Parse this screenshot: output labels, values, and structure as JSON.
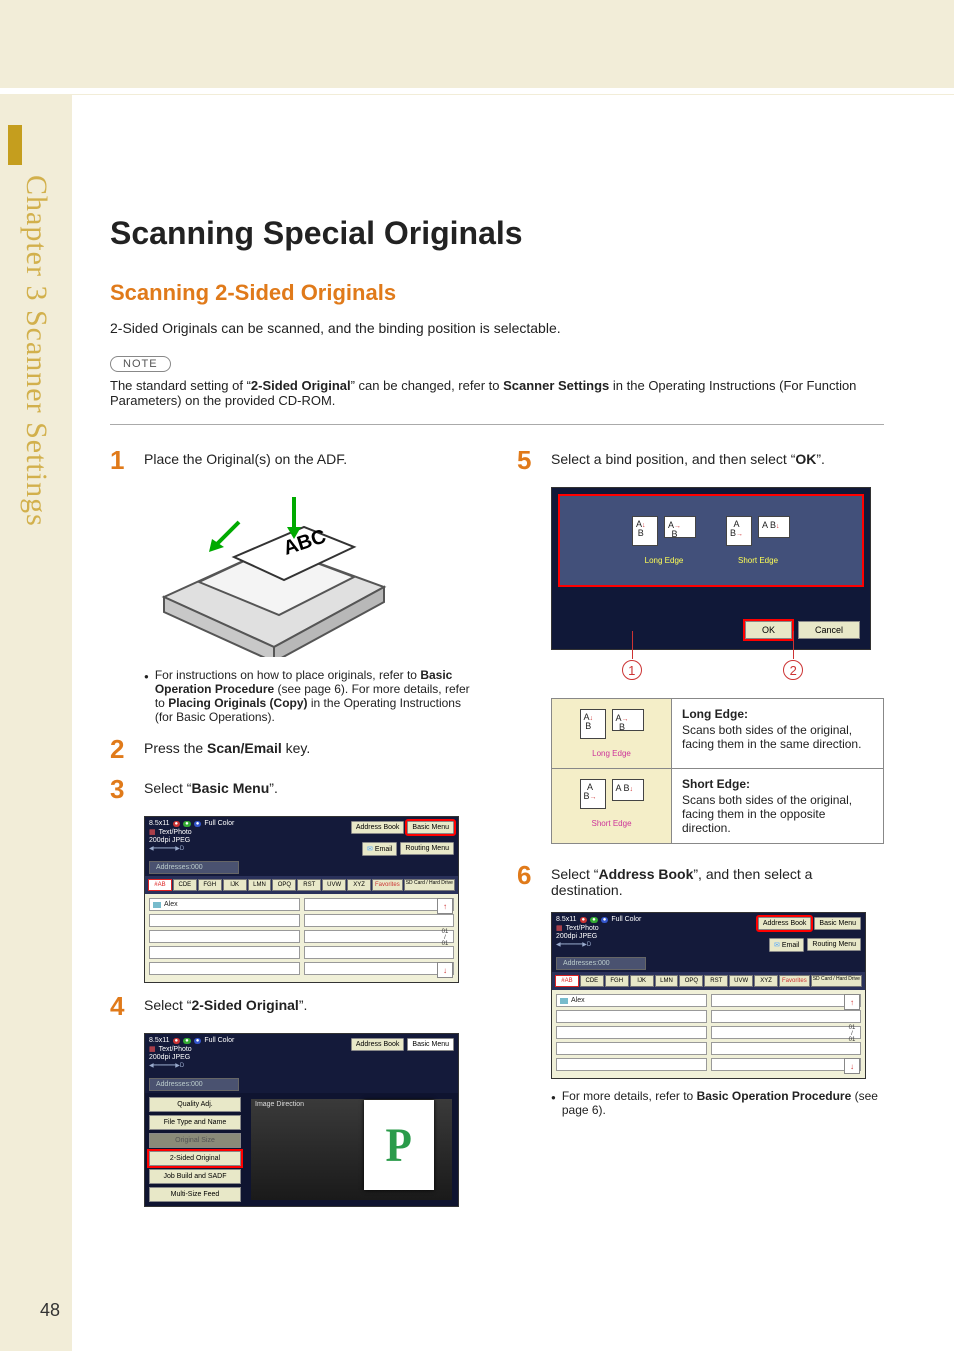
{
  "side_tab": "Chapter 3  Scanner Settings",
  "page_number": "48",
  "h1": "Scanning Special Originals",
  "h2": "Scanning 2-Sided Originals",
  "intro": "2-Sided Originals can be scanned, and the binding position is selectable.",
  "note_badge": "NOTE",
  "note_text_a": "The standard setting of “",
  "note_text_b": "2-Sided Original",
  "note_text_c": "” can be changed, refer to ",
  "note_text_d": "Scanner Settings",
  "note_text_e": " in the Operating Instructions (For Function Parameters) on the provided CD-ROM.",
  "steps_left": {
    "s1": {
      "num": "1",
      "text": "Place the Original(s) on the ADF."
    },
    "s1_bullet_a": "For instructions on how to place originals, refer to ",
    "s1_bullet_b": "Basic Operation Procedure",
    "s1_bullet_c": " (see page 6). For more details, refer to ",
    "s1_bullet_d": "Placing Originals (Copy)",
    "s1_bullet_e": " in the Operating Instructions (for Basic Operations).",
    "s2": {
      "num": "2",
      "a": "Press the ",
      "b": "Scan/Email",
      "c": " key."
    },
    "s3": {
      "num": "3",
      "a": "Select “",
      "b": "Basic Menu",
      "c": "”."
    },
    "s4": {
      "num": "4",
      "a": "Select “",
      "b": "2-Sided Original",
      "c": "”."
    }
  },
  "steps_right": {
    "s5": {
      "num": "5",
      "a": "Select a bind position, and then select “",
      "b": "OK",
      "c": "”."
    },
    "s6": {
      "num": "6",
      "a": "Select “",
      "b": "Address Book",
      "c": "”, and then select a destination."
    },
    "s6_bullet_a": "For more details, refer to ",
    "s6_bullet_b": "Basic Operation Procedure",
    "s6_bullet_c": " (see page 6)."
  },
  "adf_label": "ABC",
  "lcd_common": {
    "size": "8.5x11",
    "color": "Full Color",
    "mode": "Text/Photo",
    "res": "200dpi JPEG",
    "addresses": "Addresses:000",
    "addr_book": "Address Book",
    "basic_menu": "Basic Menu",
    "email": "Email",
    "routing": "Routing Menu",
    "tabs": [
      "#AB",
      "CDE",
      "FGH",
      "IJK",
      "LMN",
      "OPQ",
      "RST",
      "UVW",
      "XYZ",
      "Favorites",
      "SD Card / Hard Drive"
    ],
    "alex": "Alex",
    "scroll_ind": "01\n/\n01"
  },
  "lcd4": {
    "image_direction": "Image Direction",
    "quality": "Quality Adj.",
    "filetype": "File Type and Name",
    "origsize": "Original Size",
    "twosided": "2-Sided Original",
    "jobbuild": "Job Build and SADF",
    "multisize": "Multi-Size Feed"
  },
  "bind_dialog": {
    "long_edge": "Long Edge",
    "short_edge": "Short Edge",
    "ok": "OK",
    "cancel": "Cancel",
    "callout1": "1",
    "callout2": "2"
  },
  "edge_table": {
    "long_title": "Long Edge:",
    "long_desc": "Scans both sides of the original, facing them in the same direction.",
    "short_title": "Short Edge:",
    "short_desc": "Scans both sides of the original, facing them in the opposite direction.",
    "long_label": "Long Edge",
    "short_label": "Short Edge"
  }
}
